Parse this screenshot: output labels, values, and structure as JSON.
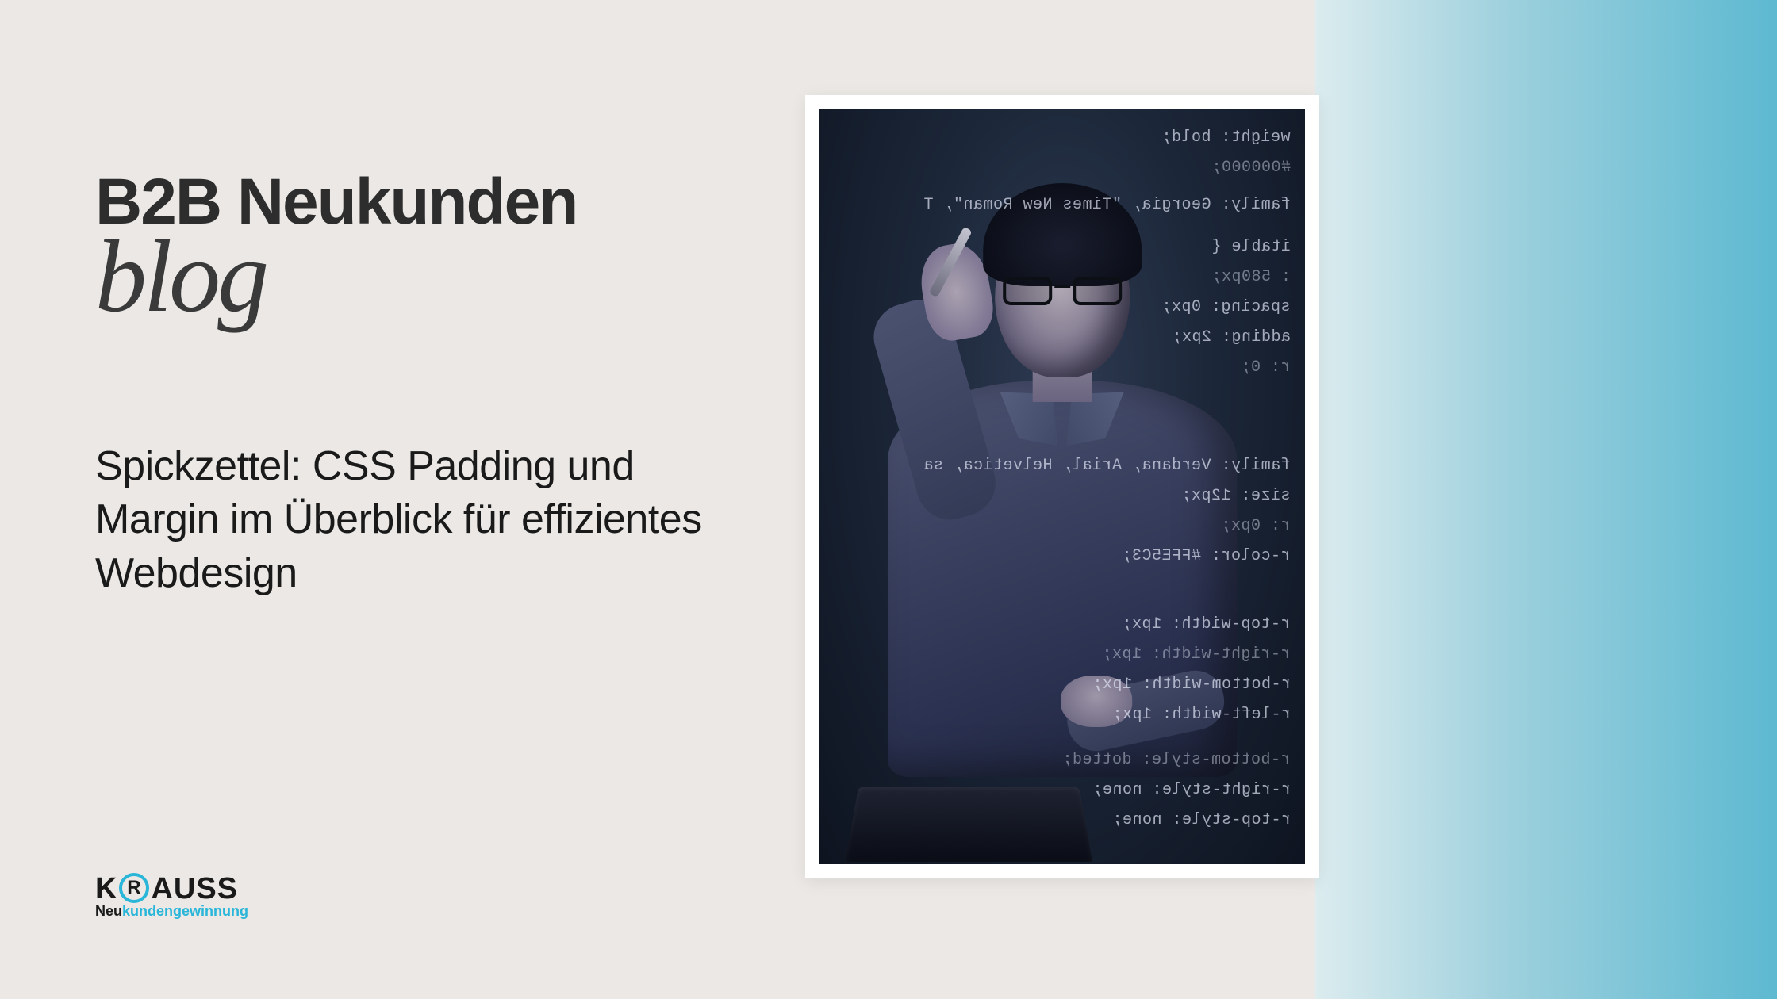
{
  "heading": {
    "main": "B2B Neukunden",
    "script": "blog"
  },
  "subtitle": "Spickzettel: CSS Padding und Margin im Überblick für effizientes Webdesign",
  "logo": {
    "pre": "K",
    "r": "R",
    "post": "AUSS",
    "sub_dark": "Neu",
    "sub_highlight": "kundengewinnung"
  },
  "code_lines": [
    "weight: bold;",
    "#000000;",
    "family: Georgia, \"Times New Roman\", T",
    "itable {",
    ": 580px;",
    "spacing: 0px;",
    "adding: 2px;",
    "r: 0;",
    "family: Verdana, Arial, Helvetica, sa",
    "size: 12px;",
    "r: 0px;",
    "r-color: #FFE5C3;",
    "r-top-width: 1px;",
    "r-right-width: 1px;",
    "r-bottom-width: 1px;",
    "r-left-width: 1px;",
    "r-bottom-style: dotted;",
    "r-right-style: none;",
    "r-top-style: none;"
  ]
}
